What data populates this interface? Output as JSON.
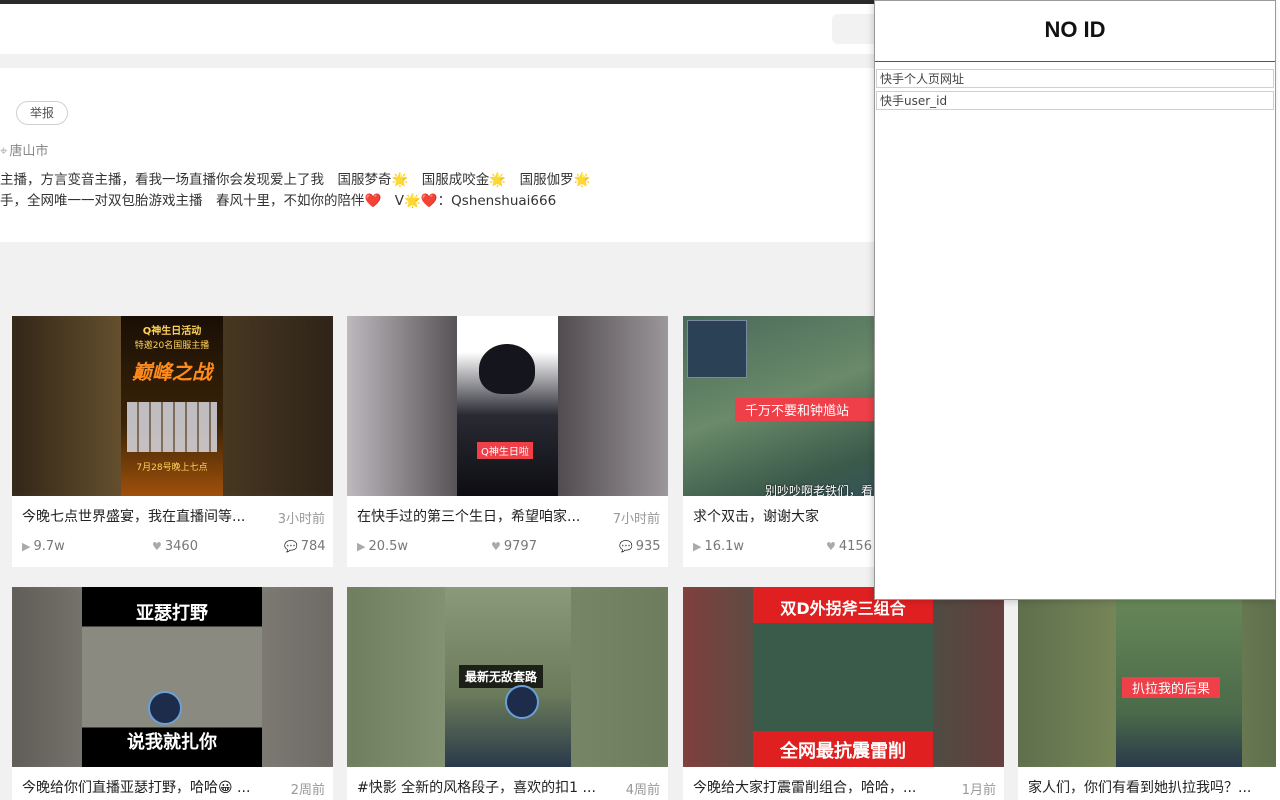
{
  "header": {
    "search_placeholder": ""
  },
  "profile": {
    "report_label": "举报",
    "location": "唐山市",
    "bio_lines": [
      "主播，方言变音主播，看我一场直播你会发现爱上了我　国服梦奇🌟　国服成咬金🌟　国服伽罗🌟",
      "手，全网唯一一对双包胎游戏主播　春风十里，不如你的陪伴❤️　V🌟❤️：Qshenshuai666"
    ]
  },
  "videos": [
    {
      "caption": "今晚七点世界盛宴，我在直播间等...",
      "time": "3小时前",
      "plays": "9.7w",
      "likes": "3460",
      "comments": "784",
      "overlay": ""
    },
    {
      "caption": "在快手过的第三个生日，希望咱家...",
      "time": "7小时前",
      "plays": "20.5w",
      "likes": "9797",
      "comments": "935",
      "overlay": "Q神生日啦"
    },
    {
      "caption": "求个双击，谢谢大家",
      "time": "",
      "plays": "16.1w",
      "likes": "4156",
      "comments": "",
      "overlay": "千万不要和钟馗站"
    },
    {
      "caption": "今晚给你们直播亚瑟打野，哈哈😀 ...",
      "time": "2周前",
      "plays": "",
      "likes": "",
      "comments": "",
      "overlay": ""
    },
    {
      "caption": "#快影 全新的风格段子，喜欢的扣1 ...",
      "time": "4周前",
      "plays": "",
      "likes": "",
      "comments": "",
      "overlay": "最新无敌套路"
    },
    {
      "caption": "今晚给大家打震雷削组合，哈哈，...",
      "time": "1月前",
      "plays": "",
      "likes": "",
      "comments": "",
      "overlay": ""
    },
    {
      "caption": "家人们，你们有看到她扒拉我吗？...",
      "time": "",
      "plays": "",
      "likes": "",
      "comments": "",
      "overlay": "扒拉我的后果"
    }
  ],
  "thumb_text": {
    "v1_title": "Q神生日活动",
    "v1_sub": "特邀20名国服主播",
    "v1_big": "巅峰之战",
    "v1_date": "7月28号晚上七点",
    "v3_bottom": "别吵吵啊老铁们，看",
    "v4_top": "亚瑟打野",
    "v4_bottom": "说我就扎你",
    "v6_top": "双D外拐斧三组合",
    "v6_bottom": "全网最抗震雷削"
  },
  "popup": {
    "title": "NO ID",
    "field1_placeholder": "快手个人页网址",
    "field2_placeholder": "快手user_id"
  },
  "colors": {
    "accent_red": "#ef3f48",
    "popup_border": "#9a9a9a"
  }
}
